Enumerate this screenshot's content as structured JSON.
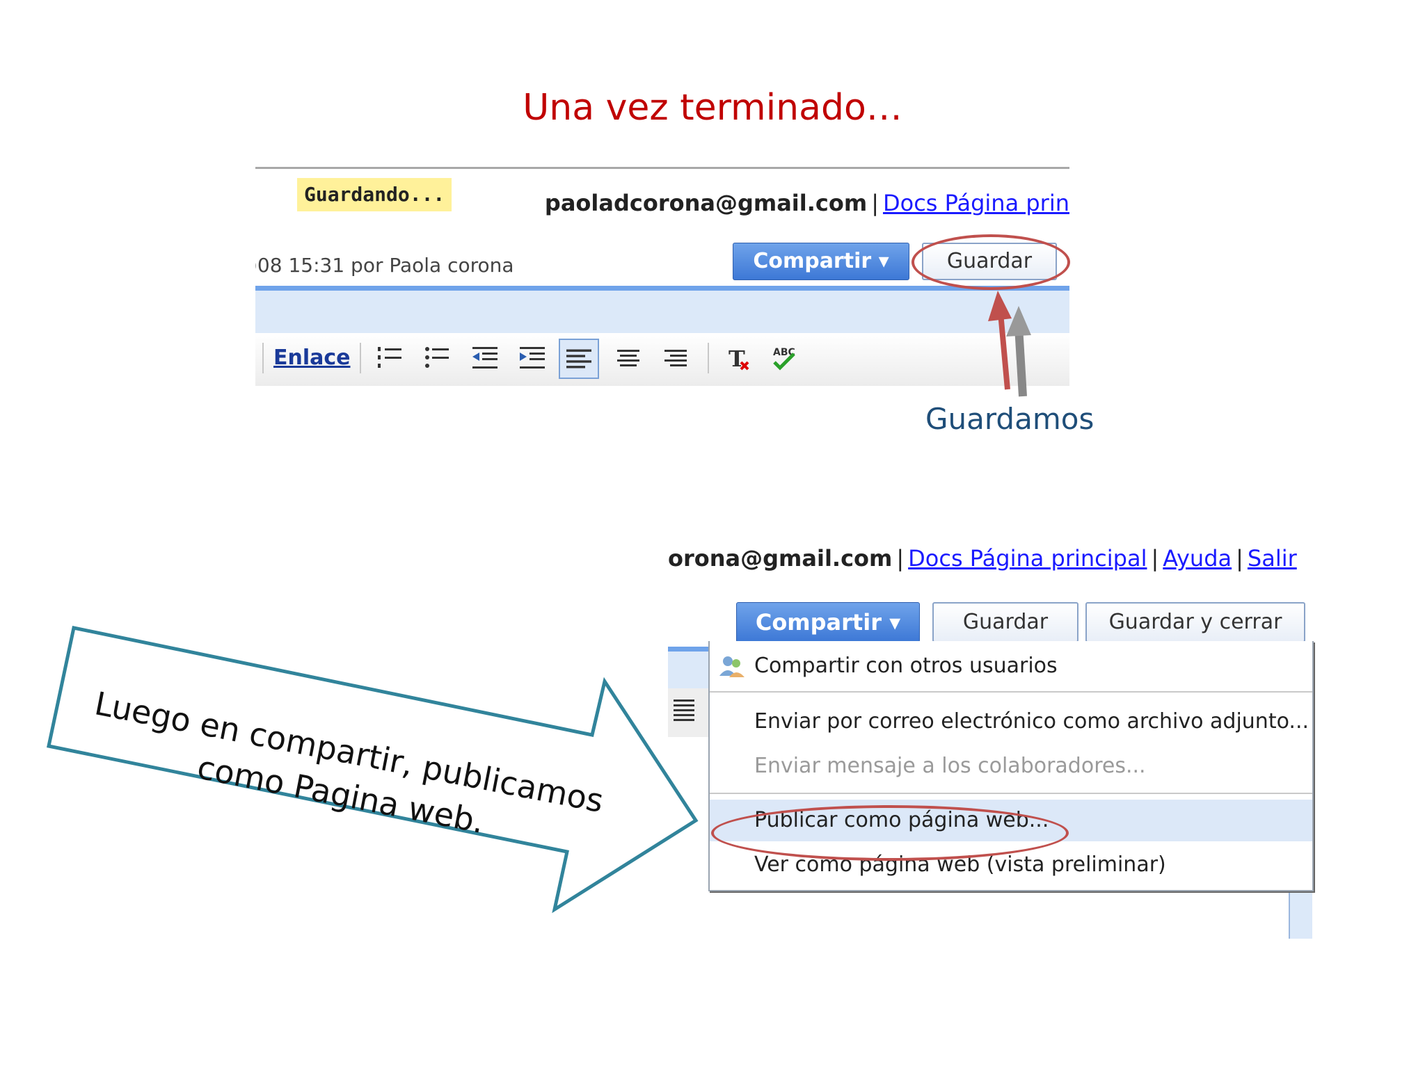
{
  "slide": {
    "title": "Una vez terminado…",
    "caption_save": "Guardamos",
    "callout_text": "Luego en compartir, publicamos como Pagina web."
  },
  "screenshot1": {
    "status_badge": "Guardando...",
    "account_email": "paoladcorona@gmail.com",
    "separator": "|",
    "link_docs": "Docs Página prin",
    "last_edit": ")08 15:31 por Paola corona",
    "share_button": "Compartir ▾",
    "save_button": "Guardar",
    "toolbar_link": "Enlace"
  },
  "screenshot2": {
    "account_email": "orona@gmail.com",
    "separator": "|",
    "link_docs": "Docs Página principal",
    "link_help": "Ayuda",
    "link_exit": "Salir",
    "share_button": "Compartir ▾",
    "save_button": "Guardar",
    "save_close_button": "Guardar y cerrar",
    "menu": {
      "share_users": "Compartir con otros usuarios",
      "email_attachment": "Enviar por correo electrónico como archivo adjunto...",
      "message_collaborators": "Enviar mensaje a los colaboradores...",
      "publish_web": "Publicar como página web...",
      "preview_web": "Ver como página web (vista preliminar)"
    }
  },
  "colors": {
    "title_red": "#c00000",
    "annotation_red": "#c0504d",
    "caption_blue": "#1f4e79",
    "callout_teal": "#31849b",
    "button_blue": "#3d78d6"
  }
}
